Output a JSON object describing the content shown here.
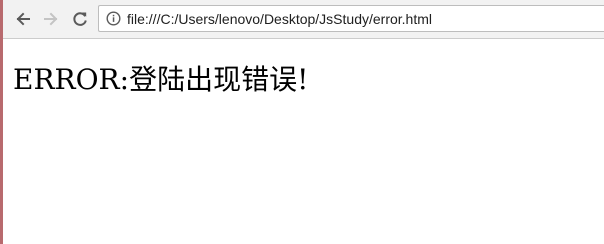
{
  "browser": {
    "address_bar": {
      "url": "file:///C:/Users/lenovo/Desktop/JsStudy/error.html"
    },
    "icons": {
      "back": "arrow-left-icon",
      "forward": "arrow-right-icon",
      "reload": "reload-icon",
      "page_info": "info-icon"
    }
  },
  "page": {
    "heading": "ERROR:登陆出现错误!"
  }
}
